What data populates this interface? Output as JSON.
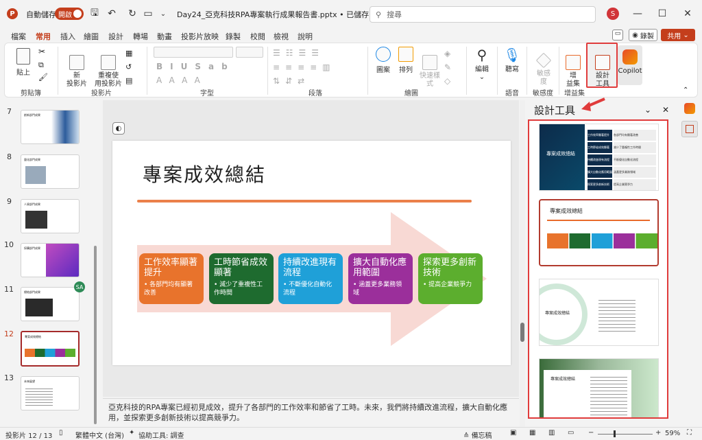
{
  "titlebar": {
    "logo": "P",
    "autosave_label": "自動儲存",
    "autosave_state": "開啟",
    "filename": "Day24_亞克科技RPA專案執行成果報告書.pptx",
    "saved_state": "• 已儲存",
    "search_placeholder": "搜尋",
    "avatar": "S"
  },
  "tabs": [
    "檔案",
    "常用",
    "插入",
    "繪圖",
    "設計",
    "轉場",
    "動畫",
    "投影片放映",
    "錄製",
    "校閱",
    "檢視",
    "說明"
  ],
  "active_tab": "常用",
  "record_label": "錄製",
  "share_label": "共用",
  "ribbon": {
    "paste": "貼上",
    "clipboard": "剪貼簿",
    "new_slide": "新\n投影片",
    "reuse_slide": "重複使\n用投影片",
    "slides_group": "投影片",
    "font_group": "字型",
    "paragraph_group": "段落",
    "shapes": "圖案",
    "arrange": "排列",
    "quick_styles": "快速樣\n式",
    "drawing_group": "繪圖",
    "edit": "編輯",
    "dictate": "聽寫",
    "voice_group": "語音",
    "sensitivity": "敏感\n度",
    "sensitivity_group": "敏感度",
    "addins": "增\n益集",
    "addins_group": "增益集",
    "designer": "設計\n工具",
    "copilot": "Copilot"
  },
  "slides": [
    {
      "num": "7",
      "title": "創新部門成果"
    },
    {
      "num": "8",
      "title": "量化部門成果"
    },
    {
      "num": "9",
      "title": "人資部門成果"
    },
    {
      "num": "10",
      "title": "採購部門成果"
    },
    {
      "num": "11",
      "title": "總結部門成果"
    },
    {
      "num": "12",
      "title": "專案成效總結"
    },
    {
      "num": "13",
      "title": "未來展望"
    }
  ],
  "comment_badge": "SA",
  "slide_main": {
    "title": "專案成效總結",
    "cards": [
      {
        "title": "工作效率顯著提升",
        "body": "• 各部門均有顯著改善",
        "color": "#e8732c"
      },
      {
        "title": "工時節省成效顯著",
        "body": "• 減少了重複性工作時間",
        "color": "#1e6b2f"
      },
      {
        "title": "持續改進現有流程",
        "body": "• 不斷優化自動化流程",
        "color": "#1fa0d8"
      },
      {
        "title": "擴大自動化應用範圍",
        "body": "• 涵蓋更多業務領域",
        "color": "#9b2f9b"
      },
      {
        "title": "探索更多創新技術",
        "body": "• 提高企業競爭力",
        "color": "#5cae2e"
      }
    ]
  },
  "notes": "亞克科技的RPA專案已經初見成效，提升了各部門的工作效率和節省了工時。未來，我們將持續改進流程，擴大自動化應用，並探索更多創新技術以提高競爭力。",
  "design_pane": {
    "title": "設計工具",
    "d1_title": "專案成效總結",
    "d1_rows": [
      "工作效率顯著提升",
      "工時節省成效顯著",
      "持續改進現有流程",
      "擴大自動化應用範圍",
      "探索更多創新技術"
    ],
    "d1_bullets": [
      "各部門均有顯著改善",
      "減少了重複性工作時間",
      "不斷優化自動化流程",
      "涵蓋更多業務領域",
      "提高企業競爭力"
    ],
    "d2_title": "專案成效總結",
    "d3_title": "專案成效總結",
    "d4_title": "專案成效總結"
  },
  "status": {
    "slide_counter": "投影片 12 / 13",
    "language": "繁體中文 (台灣)",
    "accessibility": "協助工具: 調查",
    "notes": "備忘稿",
    "zoom": "59%"
  }
}
